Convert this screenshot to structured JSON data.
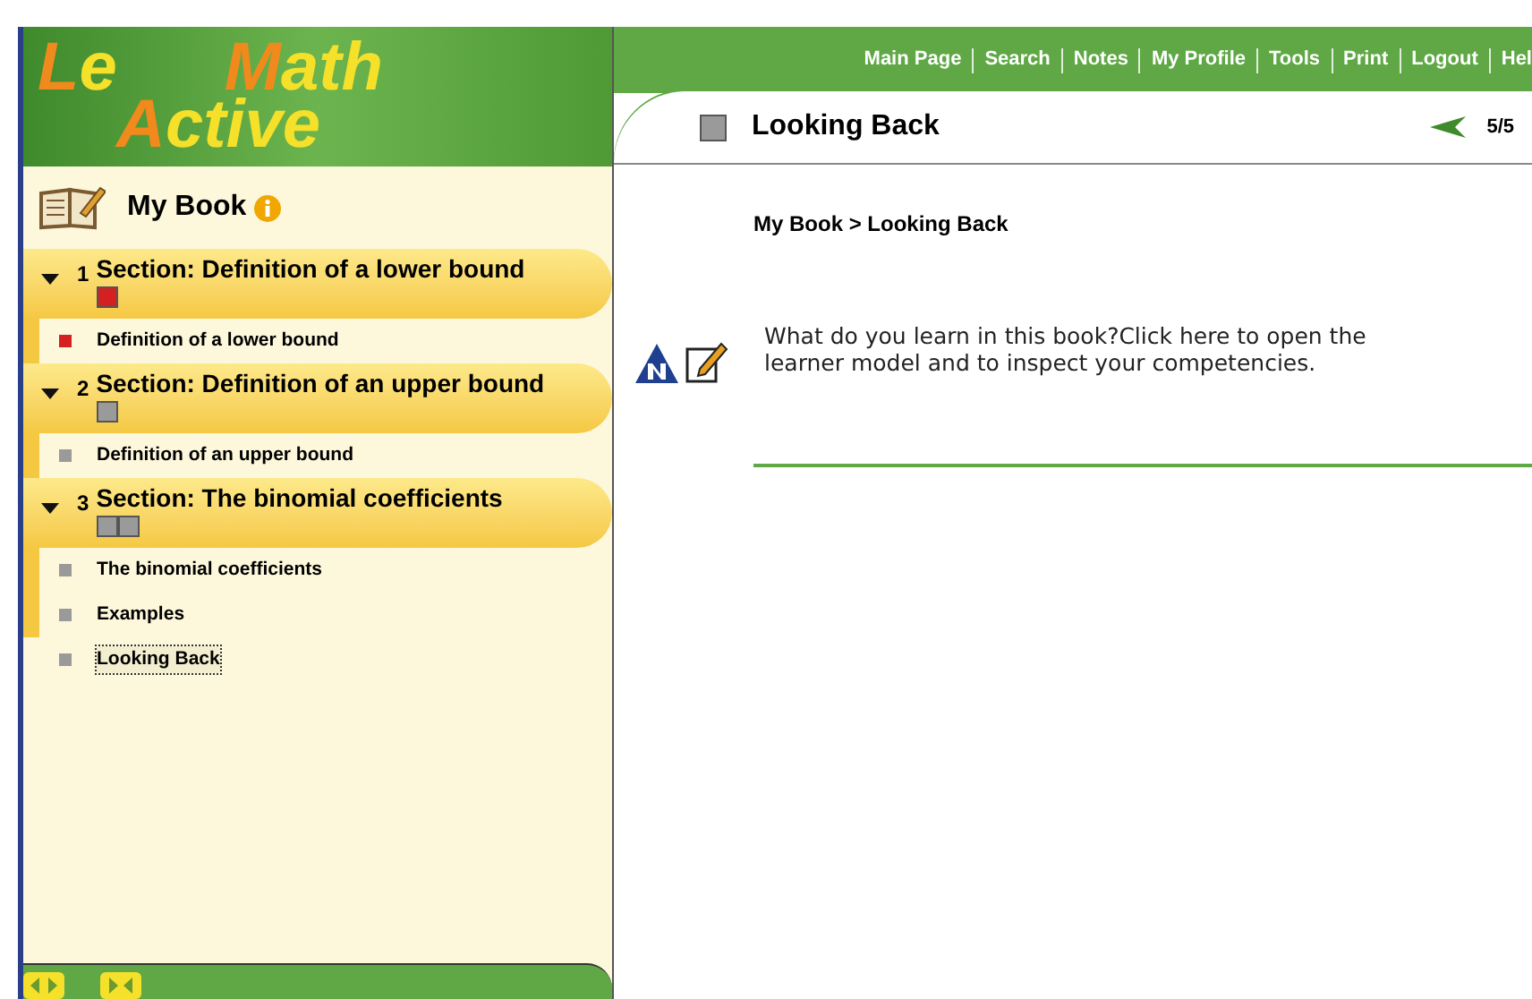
{
  "logo": {
    "line1": [
      "Le",
      "Math"
    ],
    "line2": "Active"
  },
  "sidebar": {
    "title": "My Book",
    "sections": [
      {
        "number": "1",
        "title": "Section: Definition of a lower bound",
        "expanded": true,
        "status": [
          {
            "color": "#d42020"
          }
        ],
        "items": [
          {
            "label": "Definition of a lower bound",
            "color": "#d42020",
            "selected": false
          }
        ]
      },
      {
        "number": "2",
        "title": "Section: Definition of an upper bound",
        "expanded": true,
        "status": [
          {
            "color": "#9a9a9a"
          }
        ],
        "items": [
          {
            "label": "Definition of an upper bound",
            "color": "#9a9a9a",
            "selected": false
          }
        ]
      },
      {
        "number": "3",
        "title": "Section: The binomial coefficients",
        "expanded": true,
        "status": [
          {
            "color": "#9a9a9a"
          },
          {
            "color": "#9a9a9a"
          }
        ],
        "items": [
          {
            "label": "The binomial coefficients",
            "color": "#9a9a9a",
            "selected": false
          },
          {
            "label": "Examples",
            "color": "#9a9a9a",
            "selected": false
          }
        ]
      }
    ],
    "loose_items": [
      {
        "label": "Looking Back",
        "color": "#9a9a9a",
        "selected": true
      }
    ]
  },
  "nav": [
    "Main Page",
    "Search",
    "Notes",
    "My Profile",
    "Tools",
    "Print",
    "Logout",
    "Hel"
  ],
  "page": {
    "title": "Looking Back",
    "status": {
      "color": "#9a9a9a"
    },
    "pager": "5/5",
    "breadcrumb": "My Book > Looking Back",
    "text": "What do you learn in this book?Click here to open the learner model and to inspect your competencies."
  }
}
